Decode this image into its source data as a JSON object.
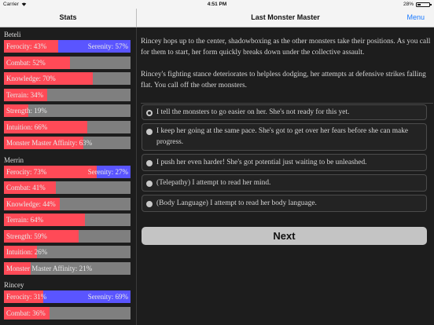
{
  "status_bar": {
    "carrier": "Carrier",
    "time": "4:51 PM",
    "battery": "28%"
  },
  "left_nav": {
    "title": "Stats"
  },
  "right_nav": {
    "title": "Last Monster Master",
    "menu_label": "Menu"
  },
  "colors": {
    "red": "#ff4a57",
    "blue": "#5a55ff",
    "gray": "#7f7f7f",
    "link": "#1a7aff"
  },
  "characters": [
    {
      "name": "Beteli",
      "stats": [
        {
          "label": "Ferocity: 43%",
          "value": 43,
          "right_label": "Serenity: 57%",
          "opposed": true
        },
        {
          "label": "Combat: 52%",
          "value": 52
        },
        {
          "label": "Knowledge: 70%",
          "value": 70
        },
        {
          "label": "Terrain: 34%",
          "value": 34
        },
        {
          "label": "Strength: 19%",
          "value": 19
        },
        {
          "label": "Intuition: 66%",
          "value": 66
        },
        {
          "label": "Monster Master Affinity: 63%",
          "value": 63
        }
      ]
    },
    {
      "name": "Merrin",
      "stats": [
        {
          "label": "Ferocity: 73%",
          "value": 73,
          "right_label": "Serenity: 27%",
          "opposed": true
        },
        {
          "label": "Combat: 41%",
          "value": 41
        },
        {
          "label": "Knowledge: 44%",
          "value": 44
        },
        {
          "label": "Terrain: 64%",
          "value": 64
        },
        {
          "label": "Strength: 59%",
          "value": 59
        },
        {
          "label": "Intuition: 26%",
          "value": 26
        },
        {
          "label": "Monster Master Affinity: 21%",
          "value": 21
        }
      ]
    },
    {
      "name": "Rincey",
      "stats": [
        {
          "label": "Ferocity: 31%",
          "value": 31,
          "right_label": "Serenity: 69%",
          "opposed": true
        },
        {
          "label": "Combat: 36%",
          "value": 36
        }
      ]
    }
  ],
  "story": {
    "paragraphs": [
      "Rincey hops up to the center, shadowboxing as the other monsters take their positions. As you call for them to start, her form quickly breaks down under the collective assault.",
      "Rincey's fighting stance deteriorates to helpless dodging, her attempts at defensive strikes falling flat. You call off the other monsters."
    ],
    "options": [
      {
        "text": "I tell the monsters to go easier on her. She's not ready for this yet.",
        "selected": true
      },
      {
        "text": "I keep her going at the same pace. She's got to get over her fears before she can make progress.",
        "selected": false
      },
      {
        "text": "I push her even harder! She's got potential just waiting to be unleashed.",
        "selected": false
      },
      {
        "text": "(Telepathy) I attempt to read her mind.",
        "selected": false
      },
      {
        "text": "(Body Language) I attempt to read her body language.",
        "selected": false
      }
    ],
    "next_label": "Next"
  }
}
